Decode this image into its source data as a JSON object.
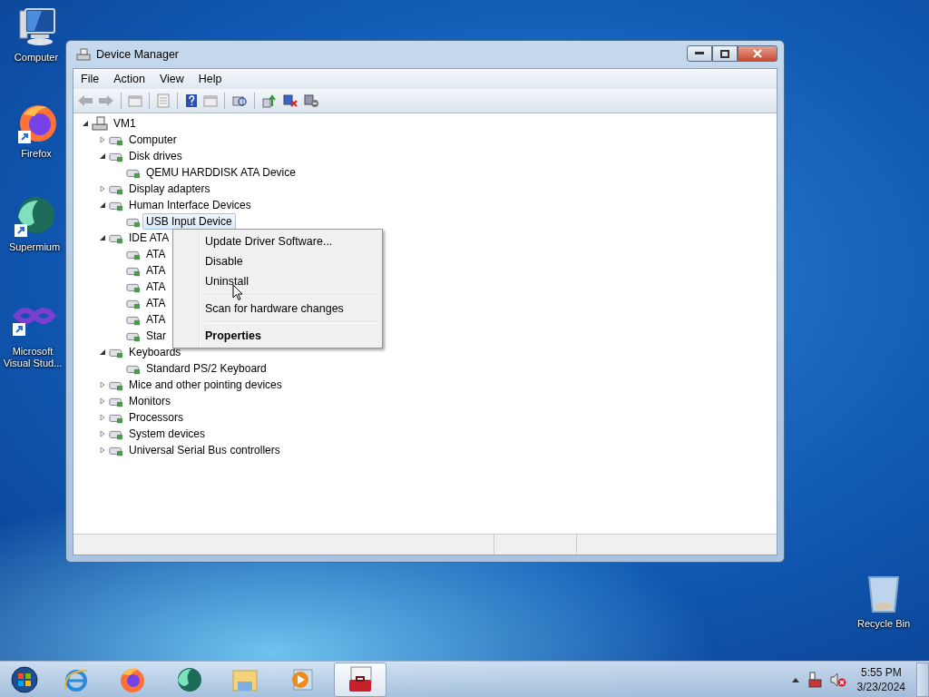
{
  "desktop_icons": [
    {
      "label": "Computer",
      "kind": "computer"
    },
    {
      "label": "Firefox",
      "kind": "firefox"
    },
    {
      "label": "Supermium",
      "kind": "supermium"
    },
    {
      "label": "Microsoft Visual Stud...",
      "kind": "vs"
    },
    {
      "label": "Recycle Bin",
      "kind": "bin"
    }
  ],
  "window": {
    "title": "Device Manager"
  },
  "menu_bar": [
    "File",
    "Action",
    "View",
    "Help"
  ],
  "tree": [
    {
      "label": "VM1",
      "expanded": true,
      "selected": false,
      "children": [
        {
          "label": "Computer",
          "expanded": false,
          "selected": false
        },
        {
          "label": "Disk drives",
          "expanded": true,
          "selected": false,
          "children": [
            {
              "label": "QEMU HARDDISK ATA Device",
              "selected": false
            }
          ]
        },
        {
          "label": "Display adapters",
          "expanded": false,
          "selected": false
        },
        {
          "label": "Human Interface Devices",
          "expanded": true,
          "selected": false,
          "children": [
            {
              "label": "USB Input Device",
              "selected": true
            }
          ]
        },
        {
          "label": "IDE ATA",
          "expanded": true,
          "selected": false,
          "children": [
            {
              "label": "ATA",
              "selected": false
            },
            {
              "label": "ATA",
              "selected": false
            },
            {
              "label": "ATA",
              "selected": false
            },
            {
              "label": "ATA",
              "selected": false
            },
            {
              "label": "ATA",
              "selected": false
            },
            {
              "label": "Star",
              "selected": false
            }
          ]
        },
        {
          "label": "Keyboards",
          "expanded": true,
          "selected": false,
          "children": [
            {
              "label": "Standard PS/2 Keyboard",
              "selected": false
            }
          ]
        },
        {
          "label": "Mice and other pointing devices",
          "expanded": false,
          "selected": false
        },
        {
          "label": "Monitors",
          "expanded": false,
          "selected": false
        },
        {
          "label": "Processors",
          "expanded": false,
          "selected": false
        },
        {
          "label": "System devices",
          "expanded": false,
          "selected": false
        },
        {
          "label": "Universal Serial Bus controllers",
          "expanded": false,
          "selected": false
        }
      ]
    }
  ],
  "context_menu": [
    {
      "kind": "item",
      "label": "Update Driver Software..."
    },
    {
      "kind": "item",
      "label": "Disable"
    },
    {
      "kind": "item",
      "label": "Uninstall"
    },
    {
      "kind": "separator"
    },
    {
      "kind": "item",
      "label": "Scan for hardware changes"
    },
    {
      "kind": "separator"
    },
    {
      "kind": "default",
      "label": "Properties"
    }
  ],
  "taskbar": [
    {
      "kind": "ie",
      "selected": false
    },
    {
      "kind": "firefox",
      "selected": false
    },
    {
      "kind": "supermium",
      "selected": false
    },
    {
      "kind": "explorer",
      "selected": false
    },
    {
      "kind": "media",
      "selected": false
    },
    {
      "kind": "devmgr",
      "selected": true
    }
  ],
  "clock": {
    "time": "5:55 PM",
    "date": "3/23/2024"
  }
}
